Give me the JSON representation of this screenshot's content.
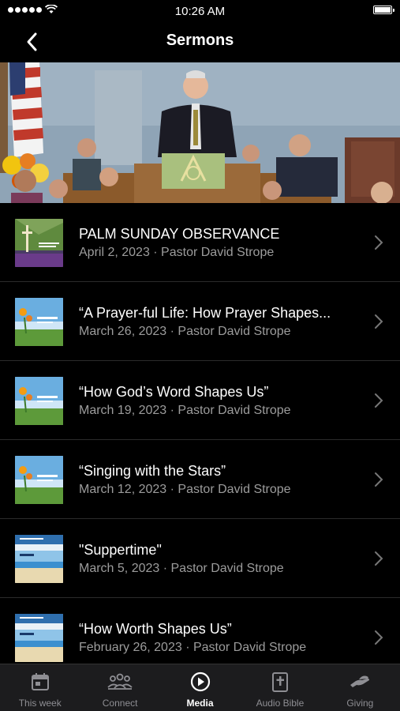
{
  "status_bar": {
    "time": "10:26 AM"
  },
  "nav": {
    "title": "Sermons"
  },
  "sermons": [
    {
      "title": "PALM SUNDAY OBSERVANCE",
      "subtitle": "April 2, 2023 · Pastor David Strope",
      "thumbnail": "palm-sunday"
    },
    {
      "title": "“A Prayer-ful Life: How Prayer Shapes...",
      "subtitle": "March 26, 2023 · Pastor David Strope",
      "thumbnail": "flowers"
    },
    {
      "title": "“How God’s Word Shapes Us”",
      "subtitle": "March 19, 2023 · Pastor David Strope",
      "thumbnail": "flowers"
    },
    {
      "title": "“Singing with the Stars”",
      "subtitle": "March 12, 2023 · Pastor David Strope",
      "thumbnail": "flowers"
    },
    {
      "title": "\"Suppertime\"",
      "subtitle": "March 5, 2023 · Pastor David Strope",
      "thumbnail": "beach"
    },
    {
      "title": "“How Worth Shapes Us”",
      "subtitle": "February 26, 2023 · Pastor David Strope",
      "thumbnail": "beach"
    }
  ],
  "tabs": [
    {
      "label": "This week",
      "icon": "calendar-icon",
      "active": false
    },
    {
      "label": "Connect",
      "icon": "people-icon",
      "active": false
    },
    {
      "label": "Media",
      "icon": "play-circle-icon",
      "active": true
    },
    {
      "label": "Audio Bible",
      "icon": "bible-icon",
      "active": false
    },
    {
      "label": "Giving",
      "icon": "giving-hand-icon",
      "active": false
    }
  ],
  "colors": {
    "background": "#000000",
    "subtitle": "#9c9c9c",
    "tab_bar": "#1c1c1e",
    "tab_inactive": "#8e8e93"
  }
}
